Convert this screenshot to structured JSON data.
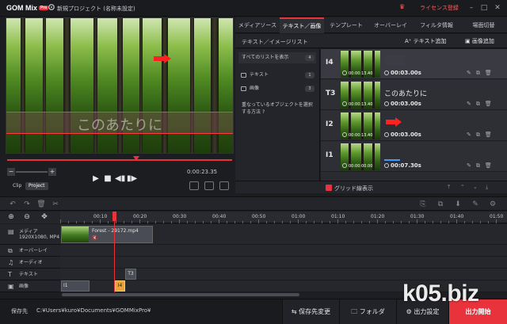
{
  "app": {
    "logo": "GOM Mix",
    "logo_badge": "Pro",
    "title": "新規プロジェクト (名称未設定)",
    "license": "ライセンス登録"
  },
  "preview": {
    "caption": "このあたりに",
    "time": "0:00:23.35",
    "clip_label": "Clip",
    "project_label": "Project"
  },
  "tabs": [
    {
      "label": "メディアソース",
      "active": false
    },
    {
      "label": "テキスト／画像",
      "active": true
    },
    {
      "label": "テンプレート",
      "active": false
    },
    {
      "label": "オーバーレイ",
      "active": false
    },
    {
      "label": "フィルタ情報",
      "active": false
    },
    {
      "label": "場面切替",
      "active": false
    }
  ],
  "subheader": {
    "list_title": "テキスト／イメージリスト",
    "add_text": "テキスト追加",
    "add_image": "画像追加"
  },
  "list": {
    "all_label": "すべてのリストを表示",
    "all_count": "4",
    "text_label": "テキスト",
    "text_count": "1",
    "image_label": "画像",
    "image_count": "3",
    "hint": "重なっているオブジェクトを選択する方法"
  },
  "items": [
    {
      "id": "I4",
      "timecode": "00:00:13.40",
      "duration": "00:03.00s",
      "kind": "box"
    },
    {
      "id": "T3",
      "timecode": "00:00:13.40",
      "duration": "00:03.00s",
      "kind": "text",
      "label": "このあたりに"
    },
    {
      "id": "I2",
      "timecode": "00:00:13.40",
      "duration": "00:03.00s",
      "kind": "arrow"
    },
    {
      "id": "I1",
      "timecode": "00:00:00.00",
      "duration": "00:07.30s",
      "kind": "line"
    }
  ],
  "grid": {
    "label": "グリッド線表示"
  },
  "timeline": {
    "ticks": [
      "00:10",
      "00:20",
      "00:30",
      "00:40",
      "00:50",
      "01:00",
      "01:10",
      "01:20",
      "01:30",
      "01:40",
      "01:50",
      "01:5"
    ],
    "tracks": [
      {
        "name": "メディア",
        "sub": "1920X1080, MP4",
        "icon": "film-icon"
      },
      {
        "name": "オーバーレイ",
        "icon": "overlay-icon"
      },
      {
        "name": "オーディオ",
        "icon": "music-icon"
      },
      {
        "name": "テキスト",
        "icon": "text-icon"
      },
      {
        "name": "画像",
        "icon": "image-icon"
      }
    ],
    "media_clip": "Forest - 29172.mp4",
    "t3_clip": "T3",
    "i1_clip": "I1",
    "i4_clip": "I4"
  },
  "bottom": {
    "save_label": "保存先",
    "path": "C:¥Users¥kuro¥Documents¥GOMMixPro¥",
    "change_dest": "保存先変更",
    "folder": "フォルダ",
    "output_settings": "出力設定",
    "start_output": "出力開始"
  },
  "watermark": "k05.biz",
  "colors": {
    "accent": "#e8323c",
    "timeline_blue": "#3b9bff",
    "selected_clip": "#e6a43a"
  }
}
